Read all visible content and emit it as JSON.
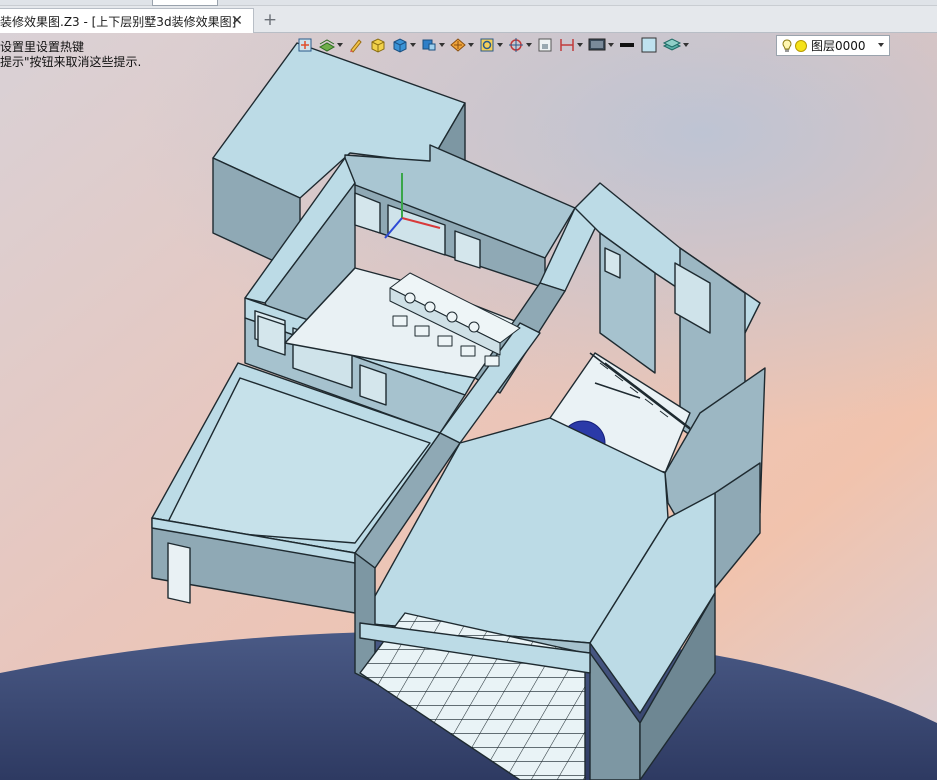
{
  "tabs": [
    {
      "label": "装修效果图.Z3 - [上下层别墅3d装修效果图]",
      "active": true
    }
  ],
  "tab_close_glyph": "✕",
  "tab_add_glyph": "+",
  "hints": {
    "line1": "设置里设置热键",
    "line2": "提示\"按钮来取消这些提示."
  },
  "toolbar": {
    "icons": [
      "view-front-icon",
      "filter-layers-icon",
      "pencil-edit-icon",
      "box-shaded-icon",
      "box-solid-icon",
      "box-wire-icon",
      "dimension-icon",
      "render-style-icon",
      "rotate-view-icon",
      "target-icon",
      "frame-icon",
      "section-icon",
      "display-mode-icon",
      "line-color-swatch",
      "fill-color-swatch",
      "layers-stack-icon"
    ],
    "line_color": "#111111",
    "fill_color": "#bfe2ef"
  },
  "layer": {
    "value": "图层0000",
    "bulb_color": "#f5e21a"
  },
  "colors": {
    "model_top": "#bcdbe6",
    "model_side": "#8fa9b5",
    "model_dark": "#6e8793",
    "edge": "#1e2a30",
    "floor_ground": "#3e4c78",
    "sky_top": "#dcd6da",
    "sky_warm": "#f0c2b2"
  }
}
